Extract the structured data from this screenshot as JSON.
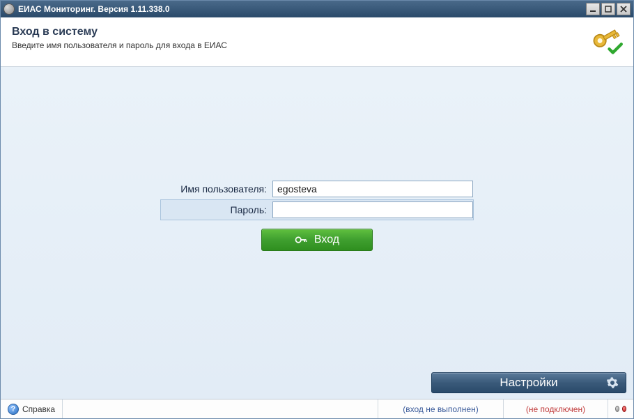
{
  "titlebar": {
    "title": "ЕИАС Мониторинг. Версия 1.11.338.0"
  },
  "header": {
    "title": "Вход в систему",
    "subtitle": "Введите имя пользователя и пароль для входа в ЕИАС"
  },
  "form": {
    "username_label": "Имя пользователя:",
    "username_value": "egosteva",
    "password_label": "Пароль:",
    "password_value": "",
    "login_button": "Вход"
  },
  "settings": {
    "label": "Настройки"
  },
  "statusbar": {
    "help_label": "Справка",
    "login_status": "(вход не выполнен)",
    "connection_status": "(не подключен)"
  }
}
